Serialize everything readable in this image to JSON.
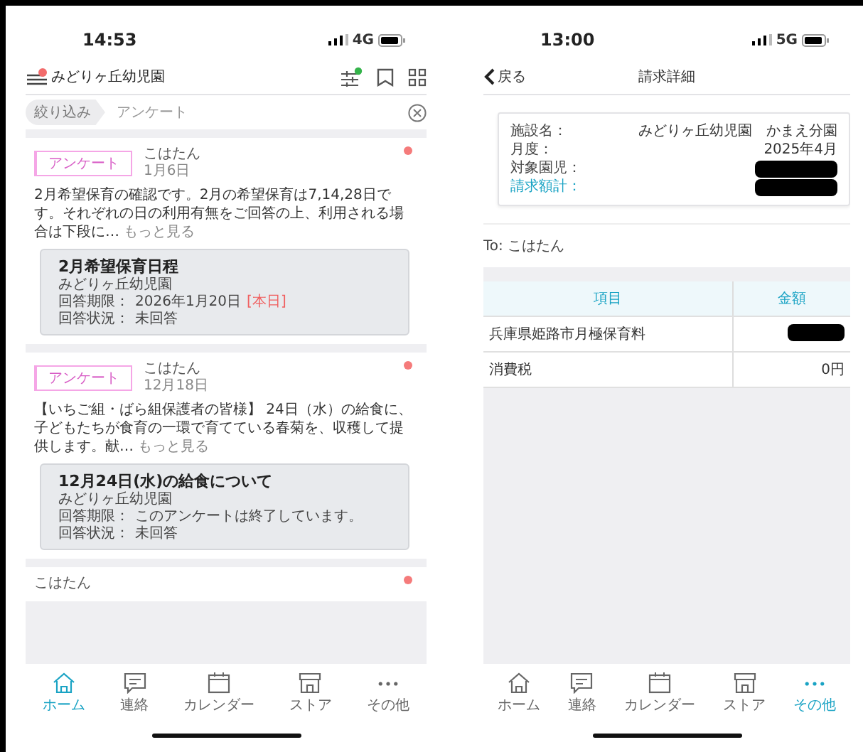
{
  "home_screen": {
    "status_bar": {
      "time": "14:53",
      "network": "4G"
    },
    "header": {
      "title": "みどりヶ丘幼児園",
      "menu_badge": true,
      "filter_badge": true
    },
    "filter": {
      "chip": "絞り込み",
      "value": "アンケート"
    },
    "posts": [
      {
        "tag": "アンケート",
        "author": "こはたん",
        "date": "1月6日",
        "unread": true,
        "body": "2月希望保育の確認です。2月の希望保育は7,14,28日です。それぞれの日の利用有無をご回答の上、利用される場合は下段に…",
        "more": "もっと見る",
        "card": {
          "title": "2月希望保育日程",
          "org": "みどりヶ丘幼児園",
          "deadline_label": "回答期限：",
          "deadline": "2026年1月20日",
          "deadline_note": "[本日]",
          "status_label": "回答状況：",
          "status": "未回答"
        }
      },
      {
        "tag": "アンケート",
        "author": "こはたん",
        "date": "12月18日",
        "unread": true,
        "body": "【いちご組・ばら組保護者の皆様】 24日（水）の給食に、子どもたちが食育の一環で育てている春菊を、収穫して提供します。献…",
        "more": "もっと見る",
        "card": {
          "title": "12月24日(水)の給食について",
          "org": "みどりヶ丘幼児園",
          "deadline_label": "回答期限：",
          "deadline": "このアンケートは終了しています。",
          "status_label": "回答状況：",
          "status": "未回答"
        }
      },
      {
        "author": "こはたん",
        "unread": true
      }
    ],
    "tab_bar": [
      {
        "label": "ホーム",
        "selected": true
      },
      {
        "label": "連絡",
        "selected": false
      },
      {
        "label": "カレンダー",
        "selected": false
      },
      {
        "label": "ストア",
        "selected": false
      },
      {
        "label": "その他",
        "selected": false
      }
    ]
  },
  "invoice_screen": {
    "status_bar": {
      "time": "13:00",
      "network": "5G"
    },
    "nav": {
      "back": "戻る",
      "title": "請求詳細"
    },
    "summary": [
      {
        "label": "施設名：",
        "value": "みどりヶ丘幼児園　かまえ分園"
      },
      {
        "label": "月度：",
        "value": "2025年4月"
      },
      {
        "label": "対象園児：",
        "redacted": true
      },
      {
        "label": "請求額計：",
        "kind": "total",
        "redacted": true
      }
    ],
    "recipient": "To: こはたん",
    "table": {
      "columns": [
        "項目",
        "金額"
      ],
      "rows": [
        {
          "item": "兵庫県姫路市月極保育料",
          "redacted": true
        },
        {
          "item": "消費税",
          "amount": "0円"
        }
      ]
    },
    "tab_bar": [
      {
        "label": "ホーム",
        "selected": false
      },
      {
        "label": "連絡",
        "selected": false
      },
      {
        "label": "カレンダー",
        "selected": false
      },
      {
        "label": "ストア",
        "selected": false
      },
      {
        "label": "その他",
        "selected": true
      }
    ]
  }
}
